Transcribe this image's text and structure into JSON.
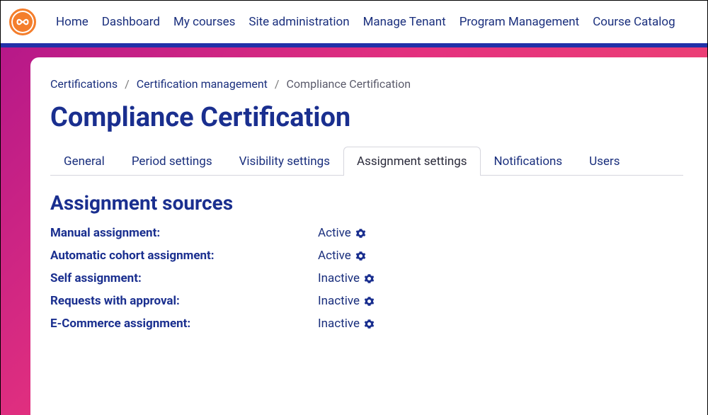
{
  "nav": {
    "items": [
      "Home",
      "Dashboard",
      "My courses",
      "Site administration",
      "Manage Tenant",
      "Program Management",
      "Course Catalog"
    ]
  },
  "breadcrumb": {
    "items": [
      "Certifications",
      "Certification management"
    ],
    "current": "Compliance Certification"
  },
  "page": {
    "title": "Compliance Certification"
  },
  "tabs": {
    "items": [
      {
        "label": "General",
        "active": false
      },
      {
        "label": "Period settings",
        "active": false
      },
      {
        "label": "Visibility settings",
        "active": false
      },
      {
        "label": "Assignment settings",
        "active": true
      },
      {
        "label": "Notifications",
        "active": false
      },
      {
        "label": "Users",
        "active": false
      }
    ]
  },
  "section": {
    "title": "Assignment sources"
  },
  "sources": [
    {
      "label": "Manual assignment:",
      "status": "Active"
    },
    {
      "label": "Automatic cohort assignment:",
      "status": "Active"
    },
    {
      "label": "Self assignment:",
      "status": "Inactive"
    },
    {
      "label": "Requests with approval:",
      "status": "Inactive"
    },
    {
      "label": "E-Commerce assignment:",
      "status": "Inactive"
    }
  ]
}
